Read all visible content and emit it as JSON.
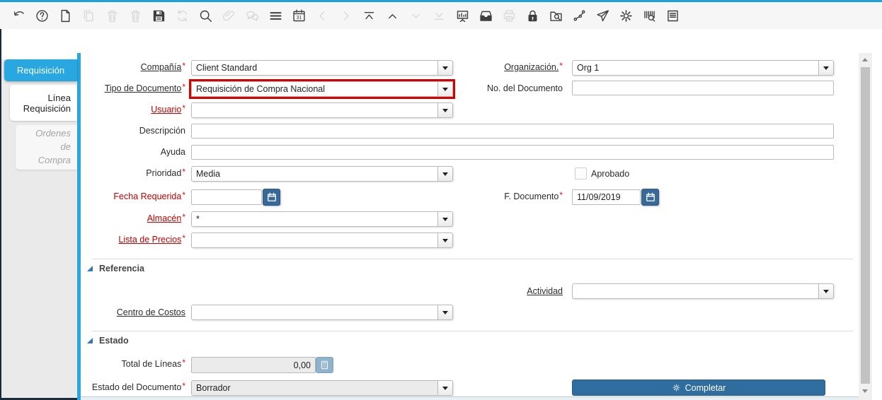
{
  "toolbar": {
    "buttons": [
      {
        "icon": "undo-icon",
        "enabled": true
      },
      {
        "icon": "help-icon",
        "enabled": true
      },
      {
        "icon": "new-record-icon",
        "enabled": true
      },
      {
        "icon": "copy-record-icon",
        "enabled": false
      },
      {
        "icon": "delete-record-icon",
        "enabled": false
      },
      {
        "icon": "delete-selection-icon",
        "enabled": false
      },
      {
        "icon": "save-icon",
        "enabled": true
      },
      {
        "icon": "refresh-icon",
        "enabled": false
      },
      {
        "icon": "find-icon",
        "enabled": true
      },
      {
        "icon": "attachment-icon",
        "enabled": false
      },
      {
        "icon": "chat-icon",
        "enabled": false
      },
      {
        "icon": "grid-toggle-icon",
        "enabled": true
      },
      {
        "icon": "calendar-icon",
        "enabled": true
      },
      {
        "icon": "previous-record-icon",
        "enabled": false
      },
      {
        "icon": "next-record-icon",
        "enabled": false
      },
      {
        "icon": "first-record-icon",
        "enabled": true
      },
      {
        "icon": "parent-record-icon",
        "enabled": true
      },
      {
        "icon": "detail-record-icon",
        "enabled": false
      },
      {
        "icon": "last-record-icon",
        "enabled": false
      },
      {
        "icon": "report-icon",
        "enabled": true
      },
      {
        "icon": "archive-icon",
        "enabled": true
      },
      {
        "icon": "print-icon",
        "enabled": false
      },
      {
        "icon": "lock-icon",
        "enabled": true
      },
      {
        "icon": "zoom-across-icon",
        "enabled": true
      },
      {
        "icon": "workflow-icon",
        "enabled": true
      },
      {
        "icon": "send-request-icon",
        "enabled": true
      },
      {
        "icon": "preferences-icon",
        "enabled": true
      },
      {
        "icon": "product-info-icon",
        "enabled": true
      },
      {
        "icon": "print-preview-icon",
        "enabled": true
      }
    ]
  },
  "sidebar": {
    "tabs": [
      {
        "label": "Requisición",
        "state": "active"
      },
      {
        "label": "Línea Requisición",
        "state": "normal"
      },
      {
        "label": "Ordenes de Compra",
        "state": "disabled"
      }
    ]
  },
  "form": {
    "compania": {
      "label": "Compañía",
      "star": "*",
      "value": "Client Standard"
    },
    "organizacion": {
      "label": "Organización.",
      "star": "*",
      "value": "Org 1"
    },
    "tipo_documento": {
      "label": "Tipo de Documento",
      "star": "*",
      "value": "Requisición de Compra Nacional"
    },
    "no_documento": {
      "label": "No. del Documento",
      "star": "",
      "value": ""
    },
    "usuario": {
      "label": "Usuario",
      "star": "*",
      "value": ""
    },
    "descripcion": {
      "label": "Descripción",
      "star": "",
      "value": ""
    },
    "ayuda": {
      "label": "Ayuda",
      "star": "",
      "value": ""
    },
    "prioridad": {
      "label": "Prioridad",
      "star": "*",
      "value": "Media"
    },
    "aprobado": {
      "label": "Aprobado",
      "checked": false
    },
    "fecha_requerida": {
      "label": "Fecha Requerida",
      "star": "*",
      "value": ""
    },
    "f_documento": {
      "label": "F. Documento",
      "star": "*",
      "value": "11/09/2019"
    },
    "almacen": {
      "label": "Almacén",
      "star": "*",
      "value": "*"
    },
    "lista_precios": {
      "label": "Lista de Precios",
      "star": "*",
      "value": ""
    },
    "actividad": {
      "label": "Actividad",
      "star": "",
      "value": ""
    },
    "centro_costos": {
      "label": "Centro de Costos",
      "star": "",
      "value": ""
    },
    "total_lineas": {
      "label": "Total de Líneas",
      "star": "*",
      "value": "0,00"
    },
    "estado_documento": {
      "label": "Estado del Documento",
      "star": "*",
      "value": "Borrador"
    },
    "completar_label": "Completar",
    "sections": {
      "referencia": "Referencia",
      "estado": "Estado"
    }
  },
  "colors": {
    "accent_blue": "#29a7e1",
    "completar_button_blue": "#2e6d9d",
    "calendar_button_blue": "#38699b",
    "highlight_red": "#d60000",
    "mandatory_label_red": "#c40000"
  }
}
